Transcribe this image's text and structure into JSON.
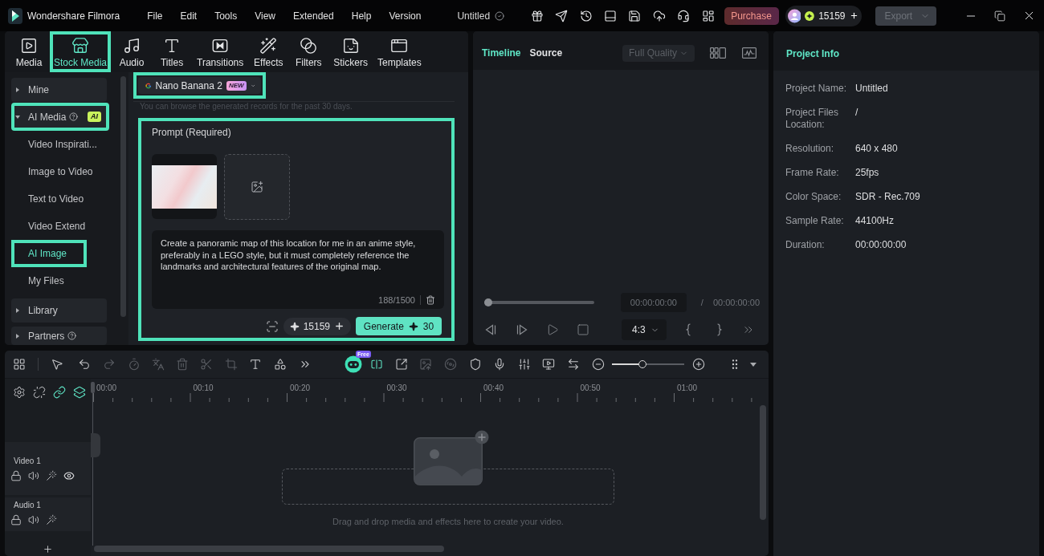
{
  "app": {
    "name": "Wondershare Filmora"
  },
  "menu": [
    "File",
    "Edit",
    "Tools",
    "View",
    "Extended",
    "Help",
    "Version"
  ],
  "project_title": "Untitled",
  "account": {
    "purchase": "Purchase",
    "credits": "15159"
  },
  "export": {
    "label": "Export",
    "disabled": true
  },
  "media_tabs": [
    {
      "label": "Media",
      "selected": false,
      "highlighted": false
    },
    {
      "label": "Stock Media",
      "selected": true,
      "highlighted": true
    },
    {
      "label": "Audio",
      "selected": false,
      "highlighted": false
    },
    {
      "label": "Titles",
      "selected": false,
      "highlighted": false
    },
    {
      "label": "Transitions",
      "selected": false,
      "highlighted": false
    },
    {
      "label": "Effects",
      "selected": false,
      "highlighted": false
    },
    {
      "label": "Filters",
      "selected": false,
      "highlighted": false
    },
    {
      "label": "Stickers",
      "selected": false,
      "highlighted": false
    },
    {
      "label": "Templates",
      "selected": false,
      "highlighted": false
    }
  ],
  "sidebar": [
    {
      "label": "Mine",
      "expanded": false,
      "highlighted": false,
      "help": false
    },
    {
      "label": "AI Media",
      "expanded": true,
      "highlighted": true,
      "help": true,
      "badge": "AI",
      "children": [
        {
          "label": "Video Inspirati...",
          "selected": false,
          "highlighted": false
        },
        {
          "label": "Image to Video",
          "selected": false,
          "highlighted": false
        },
        {
          "label": "Text to Video",
          "selected": false,
          "highlighted": false
        },
        {
          "label": "Video Extend",
          "selected": false,
          "highlighted": false
        },
        {
          "label": "AI Image",
          "selected": true,
          "highlighted": true
        },
        {
          "label": "My Files",
          "selected": false,
          "highlighted": false
        }
      ]
    },
    {
      "label": "Library",
      "expanded": false,
      "highlighted": false,
      "help": false
    },
    {
      "label": "Partners",
      "expanded": false,
      "highlighted": false,
      "help": true
    }
  ],
  "model_select": {
    "label": "Nano Banana 2",
    "badge": "NEW",
    "highlighted": true
  },
  "history_note": "You can browse the generated records for the past 30 days.",
  "prompt": {
    "title": "Prompt (Required)",
    "highlighted": true,
    "value": "Create a panoramic map of this location for me in an anime style, preferably in a LEGO style, but it must completely reference the landmarks and architectural features of the original map.",
    "count": "188/1500",
    "credits": "15159",
    "generate": {
      "label": "Generate",
      "cost": "30"
    }
  },
  "preview": {
    "tabs": [
      {
        "label": "Timeline",
        "selected": true
      },
      {
        "label": "Source",
        "selected": false
      }
    ],
    "quality": {
      "label": "Full Quality",
      "disabled": true
    },
    "playback": {
      "level": 0
    },
    "current_time": "00:00:00:00",
    "separator": "/",
    "total_time": "00:00:00:00",
    "aspect_ratio": "4:3"
  },
  "project_info": {
    "title": "Project Info",
    "rows": [
      {
        "label": "Project Name:",
        "value": "Untitled"
      },
      {
        "label": "Project Files Location:",
        "value": "/"
      },
      {
        "label": "Resolution:",
        "value": "640 x 480"
      },
      {
        "label": "Frame Rate:",
        "value": "25fps"
      },
      {
        "label": "Color Space:",
        "value": "SDR - Rec.709"
      },
      {
        "label": "Sample Rate:",
        "value": "44100Hz"
      },
      {
        "label": "Duration:",
        "value": "00:00:00:00"
      }
    ]
  },
  "timeline": {
    "ai_badge": "Free",
    "zoom": {
      "level": 0.41
    },
    "ruler": [
      "00:00",
      "00:10",
      "00:20",
      "00:30",
      "00:40",
      "00:50",
      "01:00"
    ],
    "tracks": [
      {
        "name": "Video 1",
        "kind": "video"
      },
      {
        "name": "Audio 1",
        "kind": "audio"
      }
    ],
    "drop_hint": "Drag and drop media and effects here to create your video."
  }
}
